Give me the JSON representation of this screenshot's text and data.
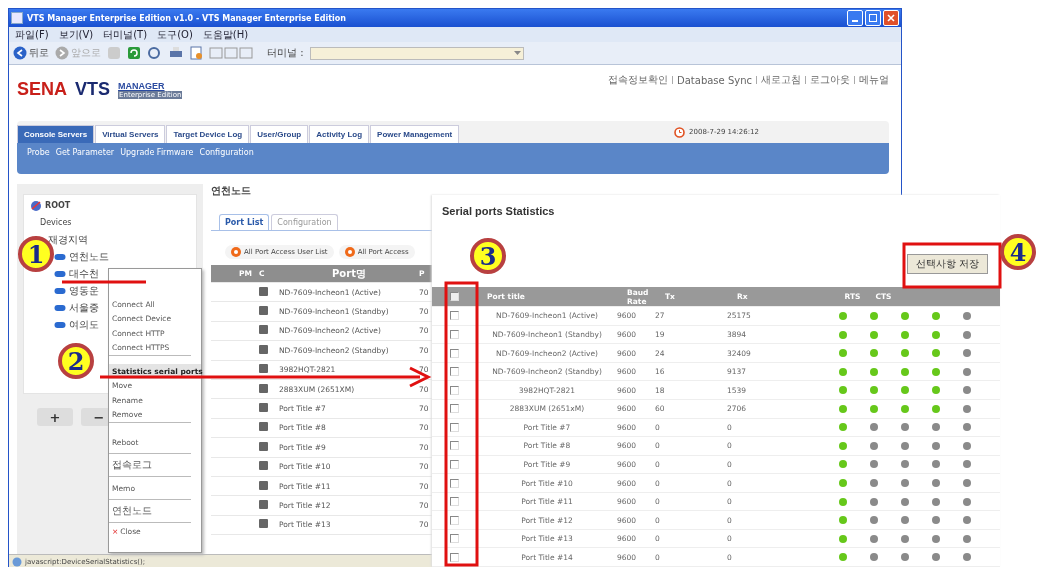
{
  "window": {
    "title": "VTS Manager Enterprise Edition v1.0 - VTS Manager Enterprise Edition"
  },
  "menu_bar": [
    "파일(F)",
    "보기(V)",
    "터미널(T)",
    "도구(O)",
    "도움말(H)"
  ],
  "toolbar": {
    "back": "뒤로",
    "forward": "앞으로",
    "terminal_label": "터미널 :"
  },
  "header_links": [
    "접속정보확인",
    "Database Sync",
    "새로고침",
    "로그아웃",
    "메뉴얼"
  ],
  "logo": {
    "brand": "SENA",
    "product": "VTS",
    "sub": "MANAGER",
    "edition": "Enterprise Edition"
  },
  "tabs": [
    {
      "label": "Console Servers",
      "selected": true
    },
    {
      "label": "Virtual Servers",
      "selected": false
    },
    {
      "label": "Target Device Log",
      "selected": false
    },
    {
      "label": "User/Group",
      "selected": false
    },
    {
      "label": "Activity Log",
      "selected": false
    },
    {
      "label": "Power Management",
      "selected": false
    }
  ],
  "clock": "2008-7-29  14:26:12",
  "subnav": [
    "Probe",
    "Get Parameter",
    "Upgrade Firmware",
    "Configuration"
  ],
  "tree": {
    "label": "ROOT",
    "children": [
      {
        "label": "Devices",
        "children": [
          {
            "label": "재경지역",
            "children": [
              {
                "label": "연천노드"
              },
              {
                "label": "대수천"
              },
              {
                "label": "영동운"
              },
              {
                "label": "서울중"
              },
              {
                "label": "여의도"
              }
            ]
          }
        ]
      }
    ]
  },
  "tree_buttons": [
    "+",
    "−"
  ],
  "node_title": "연천노드",
  "content_tabs": [
    {
      "label": "Port List",
      "selected": true
    },
    {
      "label": "Configuration",
      "selected": false
    }
  ],
  "action_buttons": [
    "All Port Access User List",
    "All Port Access"
  ],
  "port_table": {
    "columns": [
      "PM",
      "C",
      "Port명",
      "P"
    ],
    "rows": [
      {
        "name": "ND-7609-Incheon1 (Active)",
        "column_4": "70"
      },
      {
        "name": "ND-7609-Incheon1 (Standby)",
        "column_4": "70"
      },
      {
        "name": "ND-7609-Incheon2 (Active)",
        "column_4": "70"
      },
      {
        "name": "ND-7609-Incheon2 (Standby)",
        "column_4": "70"
      },
      {
        "name": "3982HQT-2821",
        "column_4": "70"
      },
      {
        "name": "2883XUM (2651XM)",
        "column_4": "70"
      },
      {
        "name": "Port Title #7",
        "column_4": "70"
      },
      {
        "name": "Port Title #8",
        "column_4": "70"
      },
      {
        "name": "Port Title #9",
        "column_4": "70"
      },
      {
        "name": "Port Title #10",
        "column_4": "70"
      },
      {
        "name": "Port Title #11",
        "column_4": "70"
      },
      {
        "name": "Port Title #12",
        "column_4": "70"
      },
      {
        "name": "Port Title #13",
        "column_4": "70"
      }
    ]
  },
  "context_menu": [
    {
      "label": "Connect All",
      "selected": false,
      "kind": "item"
    },
    {
      "label": "Connect Device",
      "selected": false,
      "kind": "item"
    },
    {
      "label": "Connect HTTP",
      "selected": false,
      "kind": "item"
    },
    {
      "label": "Connect HTTPS",
      "selected": false,
      "kind": "item-last"
    },
    {
      "label": "Statistics serial ports",
      "selected": true,
      "kind": "group"
    },
    {
      "label": "Move",
      "selected": false,
      "kind": "group"
    },
    {
      "label": "Rename",
      "selected": false,
      "kind": "item"
    },
    {
      "label": "Remove",
      "selected": false,
      "kind": "item-last"
    },
    {
      "label": "Reboot",
      "selected": false,
      "kind": "group-last"
    },
    {
      "label": "접속로그",
      "selected": false,
      "kind": "group-last"
    },
    {
      "label": "Memo",
      "selected": false,
      "kind": "group-last"
    },
    {
      "label": "연천노드",
      "selected": false,
      "kind": "group-last"
    },
    {
      "label": "Close",
      "selected": false,
      "kind": "close",
      "icon": "×"
    }
  ],
  "status_bar": "javascript:DeviceSerialStatistics();",
  "stats": {
    "title": "Serial ports Statistics",
    "save_button": "선택사항 저장",
    "header_checked": false,
    "columns": [
      "Port title",
      "Baud Rate",
      "Tx",
      "Rx",
      "RTS",
      "CTS"
    ],
    "rows": [
      {
        "title": "ND-7609-Incheon1 (Active)",
        "baud": "9600",
        "tx": "27",
        "rx": "25175",
        "checked": false,
        "signals": [
          true,
          true,
          true,
          true,
          false
        ]
      },
      {
        "title": "ND-7609-Incheon1 (Standby)",
        "baud": "9600",
        "tx": "19",
        "rx": "3894",
        "checked": false,
        "signals": [
          true,
          true,
          true,
          true,
          false
        ]
      },
      {
        "title": "ND-7609-Incheon2 (Active)",
        "baud": "9600",
        "tx": "24",
        "rx": "32409",
        "checked": false,
        "signals": [
          true,
          true,
          true,
          true,
          false
        ]
      },
      {
        "title": "ND-7609-Incheon2 (Standby)",
        "baud": "9600",
        "tx": "16",
        "rx": "9137",
        "checked": false,
        "signals": [
          true,
          true,
          true,
          true,
          false
        ]
      },
      {
        "title": "3982HQT-2821",
        "baud": "9600",
        "tx": "18",
        "rx": "1539",
        "checked": false,
        "signals": [
          true,
          true,
          true,
          true,
          false
        ]
      },
      {
        "title": "2883XUM (2651xM)",
        "baud": "9600",
        "tx": "60",
        "rx": "2706",
        "checked": false,
        "signals": [
          true,
          true,
          true,
          true,
          false
        ]
      },
      {
        "title": "Port Title #7",
        "baud": "9600",
        "tx": "0",
        "rx": "0",
        "checked": false,
        "signals": [
          true,
          false,
          false,
          false,
          false
        ]
      },
      {
        "title": "Port Title #8",
        "baud": "9600",
        "tx": "0",
        "rx": "0",
        "checked": false,
        "signals": [
          true,
          false,
          false,
          false,
          false
        ]
      },
      {
        "title": "Port Title #9",
        "baud": "9600",
        "tx": "0",
        "rx": "0",
        "checked": false,
        "signals": [
          true,
          false,
          false,
          false,
          false
        ]
      },
      {
        "title": "Port Title #10",
        "baud": "9600",
        "tx": "0",
        "rx": "0",
        "checked": false,
        "signals": [
          true,
          false,
          false,
          false,
          false
        ]
      },
      {
        "title": "Port Title #11",
        "baud": "9600",
        "tx": "0",
        "rx": "0",
        "checked": false,
        "signals": [
          true,
          false,
          false,
          false,
          false
        ]
      },
      {
        "title": "Port Title #12",
        "baud": "9600",
        "tx": "0",
        "rx": "0",
        "checked": false,
        "signals": [
          true,
          false,
          false,
          false,
          false
        ]
      },
      {
        "title": "Port Title #13",
        "baud": "9600",
        "tx": "0",
        "rx": "0",
        "checked": false,
        "signals": [
          true,
          false,
          false,
          false,
          false
        ]
      },
      {
        "title": "Port Title #14",
        "baud": "9600",
        "tx": "0",
        "rx": "0",
        "checked": false,
        "signals": [
          true,
          false,
          false,
          false,
          false
        ]
      }
    ]
  },
  "callouts": [
    "1",
    "2",
    "3",
    "4"
  ]
}
